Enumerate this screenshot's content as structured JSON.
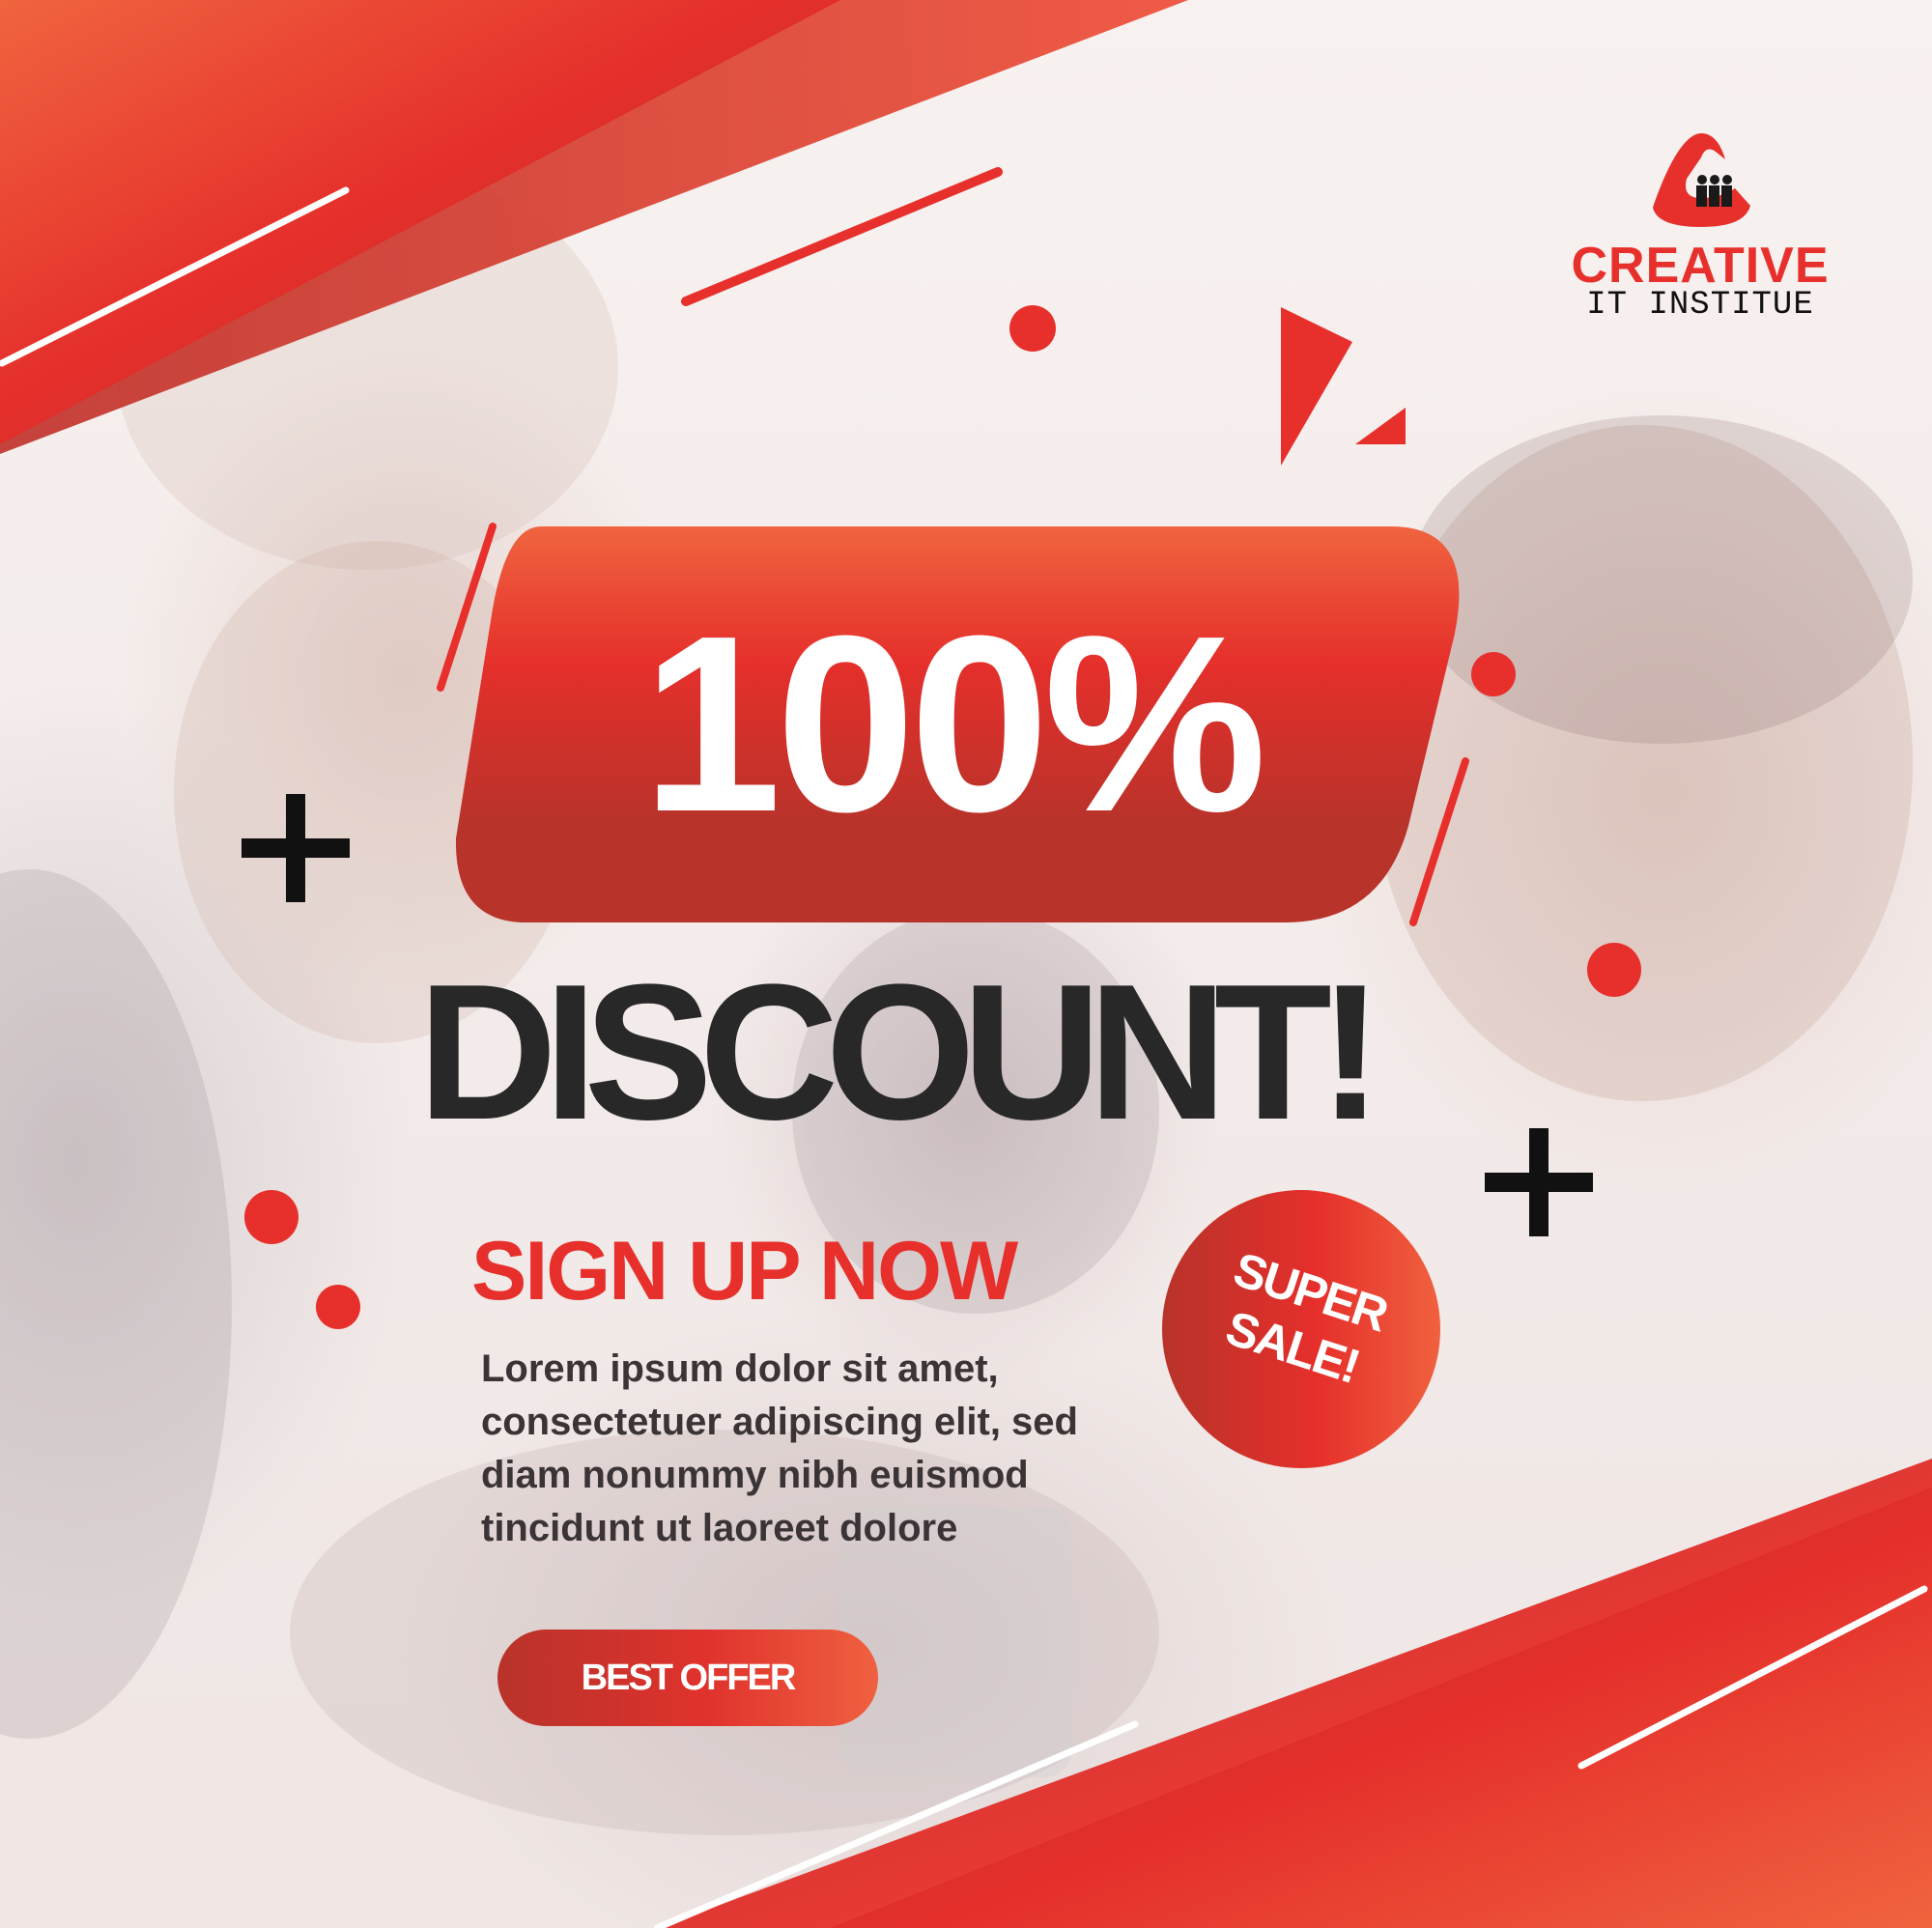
{
  "brand": {
    "name_line1": "CREATIVE",
    "name_line2": "IT INSTITUE",
    "primary_color": "#e7302c",
    "dark_red": "#b8332a",
    "orange": "#f0613e",
    "logo_icon": "creative-it-logo-icon"
  },
  "headline": {
    "percent": "100%",
    "discount": "DISCOUNT!"
  },
  "cta": {
    "signup": "SIGN UP NOW",
    "body": "Lorem ipsum dolor sit amet, consectetuer adipiscing elit, sed diam nonummy nibh euismod tincidunt ut laoreet dolore",
    "button": "BEST OFFER"
  },
  "badge": {
    "text": "SUPER SALE!"
  },
  "icons": [
    "plus-icon",
    "circle-dot",
    "triangle-shape",
    "diagonal-line"
  ]
}
